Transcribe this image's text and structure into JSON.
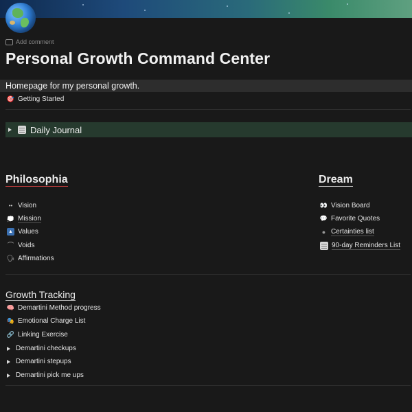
{
  "page": {
    "title": "Personal Growth Command Center",
    "add_comment": "Add comment",
    "subtitle": "Homepage for my personal growth.",
    "icon": "globe-icon"
  },
  "getting_started": {
    "label": "Getting Started",
    "icon": "dart-icon"
  },
  "daily_journal": {
    "label": "Daily Journal",
    "icon": "memo-icon"
  },
  "philosophia": {
    "heading": "Philosophia",
    "items": [
      {
        "label": "Vision",
        "icon": "glasses-icon"
      },
      {
        "label": "Mission",
        "icon": "thought-bubble-icon"
      },
      {
        "label": "Values",
        "icon": "up-arrow-icon"
      },
      {
        "label": "Voids",
        "icon": "arc-icon"
      },
      {
        "label": "Affirmations",
        "icon": "speaking-head-icon"
      }
    ]
  },
  "dream": {
    "heading": "Dream",
    "items": [
      {
        "label": "Vision Board",
        "icon": "eyes-icon"
      },
      {
        "label": "Favorite Quotes",
        "icon": "speech-bubble-icon"
      },
      {
        "label": "Certainties list",
        "icon": "rock-icon"
      },
      {
        "label": "90-day Reminders List",
        "icon": "notepad-icon"
      }
    ]
  },
  "growth_tracking": {
    "heading": "Growth Tracking",
    "items": [
      {
        "label": "Demartini Method progress",
        "icon": "brain-icon"
      },
      {
        "label": "Emotional Charge List",
        "icon": "theater-masks-icon"
      },
      {
        "label": "Linking Exercise",
        "icon": "link-icon"
      }
    ],
    "toggles": [
      {
        "label": "Demartini checkups"
      },
      {
        "label": "Demartini stepups"
      },
      {
        "label": "Demartini pick me ups"
      }
    ]
  }
}
